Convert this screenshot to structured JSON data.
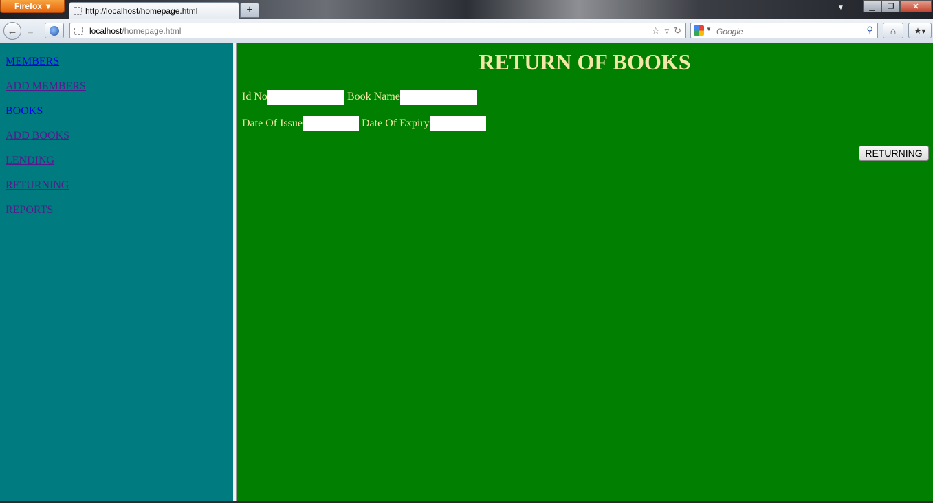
{
  "browser": {
    "menu_button": "Firefox",
    "tab_title": "http://localhost/homepage.html",
    "new_tab": "+",
    "url_host": "localhost",
    "url_path": "/homepage.html",
    "search_placeholder": "Google"
  },
  "sidebar": {
    "links": [
      {
        "label": "MEMBERS",
        "state": "unvisited"
      },
      {
        "label": "ADD MEMBERS",
        "state": "visited"
      },
      {
        "label": "BOOKS",
        "state": "unvisited"
      },
      {
        "label": "ADD BOOKS",
        "state": "visited"
      },
      {
        "label": "LENDING",
        "state": "visited"
      },
      {
        "label": "RETURNING",
        "state": "visited"
      },
      {
        "label": "REPORTS",
        "state": "visited"
      }
    ]
  },
  "main": {
    "title": "RETURN OF BOOKS",
    "id_no_label": "Id No",
    "id_no_value": "",
    "book_name_label": "Book Name",
    "book_name_value": "",
    "date_of_issue_label": "Date Of Issue",
    "date_of_issue_value": "",
    "date_of_expiry_label": "Date Of Expiry",
    "date_of_expiry_value": "",
    "submit_label": "RETURNING"
  },
  "colors": {
    "sidebar_bg": "#007b7f",
    "main_bg": "#007f00",
    "text": "#f2e7a6",
    "link_unvisited": "#0000ee",
    "link_visited": "#551a8b"
  }
}
